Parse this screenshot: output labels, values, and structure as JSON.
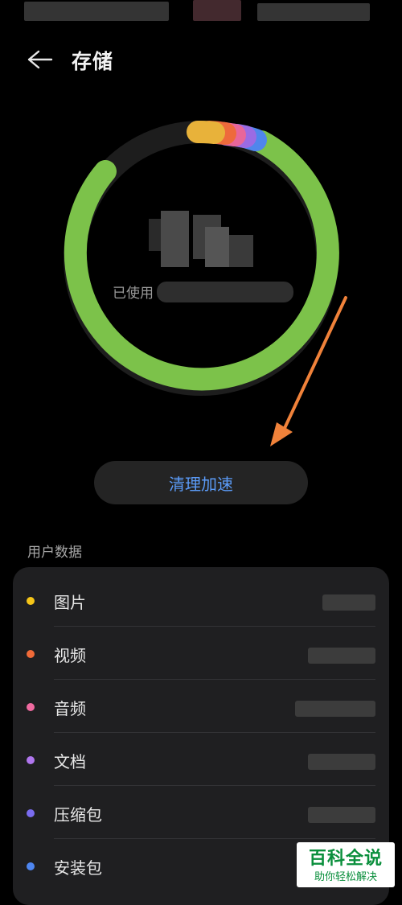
{
  "header": {
    "title": "存储"
  },
  "storage": {
    "used_label": "已使用",
    "ring_colors": {
      "green": "#7cc24a",
      "yellow": "#e8b23a",
      "orange": "#ee6a3c",
      "pink": "#e8669a",
      "purple": "#9b6be3",
      "blue": "#4f86ec",
      "track": "#1d1d1d"
    }
  },
  "clean_button": {
    "label": "清理加速",
    "color": "#5b9bf7"
  },
  "user_data": {
    "title": "用户数据",
    "items": [
      {
        "label": "图片",
        "color": "#f5c518",
        "icon": "yellow-dot"
      },
      {
        "label": "视频",
        "color": "#f06a38",
        "icon": "orange-dot"
      },
      {
        "label": "音频",
        "color": "#f06aa0",
        "icon": "pink-dot"
      },
      {
        "label": "文档",
        "color": "#b076ee",
        "icon": "purple-dot"
      },
      {
        "label": "压缩包",
        "color": "#7a6cf0",
        "icon": "violet-dot"
      },
      {
        "label": "安装包",
        "color": "#4e86f0",
        "icon": "blue-dot"
      }
    ]
  },
  "watermark": {
    "title": "百科全说",
    "subtitle": "助你轻松解决"
  }
}
